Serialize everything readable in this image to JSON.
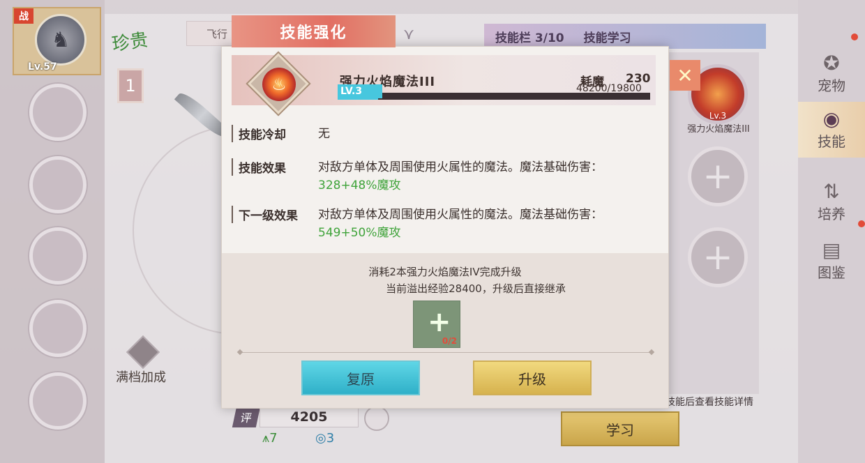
{
  "pet": {
    "badge": "战",
    "level": "Lv.57",
    "portrait_icon": "boar-icon"
  },
  "rarity": {
    "label": "珍贵",
    "number": "1"
  },
  "full_bonus": {
    "label": "满档加成"
  },
  "tabs": {
    "fly": "飞行",
    "title": "技能强化"
  },
  "skill_bar": {
    "slots_label": "技能栏 3/10",
    "learn_tab": "技能学习"
  },
  "slot_skill": {
    "name": "强力火焰魔法III",
    "level": "Lv.3"
  },
  "hint": "技能后查看技能详情",
  "learn_button": "学习",
  "rating": {
    "icon": "评",
    "value": "4205",
    "green_stat": "7",
    "blue_stat": "3"
  },
  "nav": [
    {
      "label": "宠物",
      "icon": "paw-icon"
    },
    {
      "label": "技能",
      "icon": "swirl-icon"
    },
    {
      "label": "培养",
      "icon": "chat-up-icon"
    },
    {
      "label": "图鉴",
      "icon": "book-icon"
    }
  ],
  "modal": {
    "skill_name": "强力火焰魔法III",
    "cost_label": "耗魔",
    "cost_value": "230",
    "level_badge": "LV.3",
    "exp_text": "48200/19800",
    "exp_fraction": 0.13,
    "rows": [
      {
        "label": "技能冷却",
        "value": "无",
        "extra": ""
      },
      {
        "label": "技能效果",
        "value": "对敌方单体及周围使用火属性的魔法。魔法基础伤害：",
        "extra": "328+48%魔攻"
      },
      {
        "label": "下一级效果",
        "value": "对敌方单体及周围使用火属性的魔法。魔法基础伤害：",
        "extra": "549+50%魔攻"
      }
    ],
    "consume_line1": "消耗2本强力火焰魔法IV完成升级",
    "consume_line2": "当前溢出经验28400，升级后直接继承",
    "book_count": "0/2",
    "reset_button": "复原",
    "upgrade_button": "升级"
  },
  "colors": {
    "accent_cyan": "#47c7de",
    "title_red": "#e26f63",
    "gold": "#d6b24e",
    "green": "#3fa33a"
  }
}
